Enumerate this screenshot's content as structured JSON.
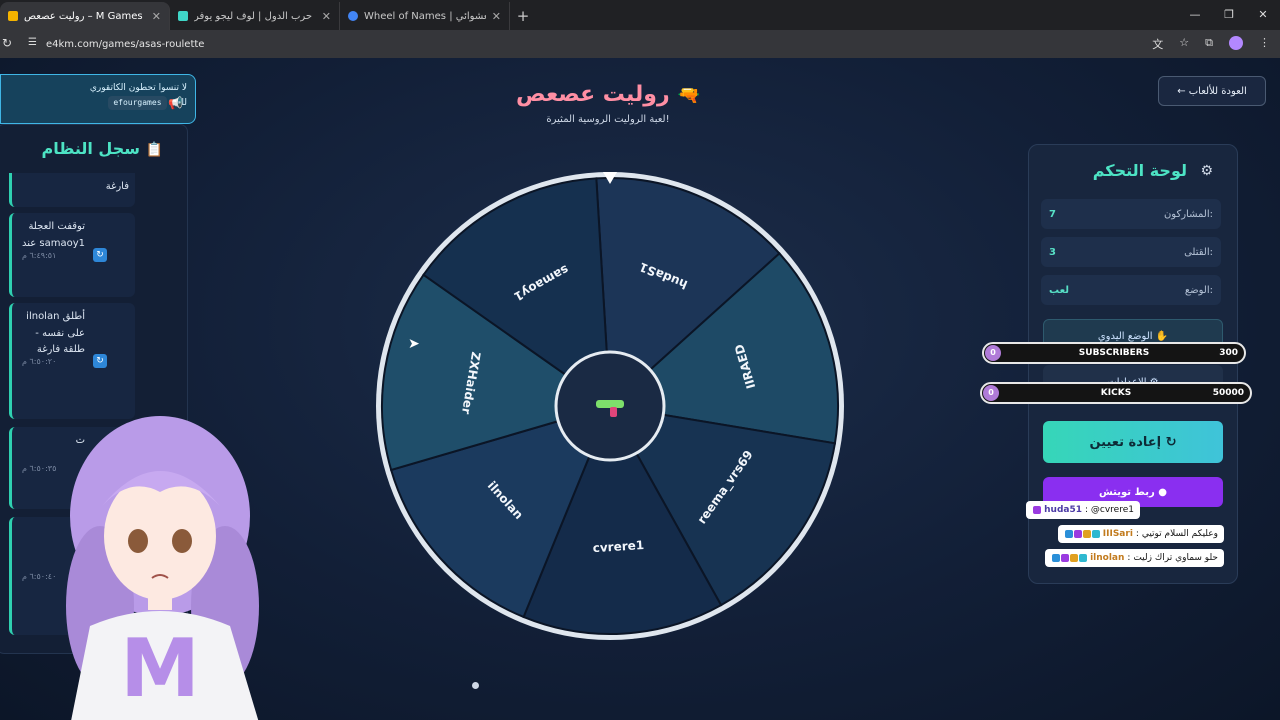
{
  "browser": {
    "tabs": [
      {
        "title": "روليت عصعص – M Games",
        "fav_color": "#f5b400"
      },
      {
        "title": "لعبة حرب الدول | لوف ليجو يوفر",
        "fav_color": "#3fd6c7"
      },
      {
        "title": "Wheel of Names | اسم العشوائي",
        "fav_color": "#4285f4"
      }
    ],
    "url": "e4km.com/games/asas-roulette"
  },
  "notice": {
    "text": "لا تنسوا تحطون الكاتقوري",
    "code": "efourgames",
    "suffix": "للعبة"
  },
  "syslog": {
    "title": "سجل النظام",
    "items": [
      {
        "text": "فارغة",
        "time": ""
      },
      {
        "text": "توقفت العجلة عند samaoy1",
        "time": "٦:٤٩:٥١ م"
      },
      {
        "text": "ilnolan أطلق على نفسه - طلقة فارغة",
        "time": "٦:٥٠:٢٠ م"
      },
      {
        "text": "ت",
        "time": "٦:٥٠:٣٥ م"
      },
      {
        "text": "",
        "time": "٦:٥٠:٤٠ م"
      }
    ]
  },
  "header": {
    "back_label": "← العودة للألعاب",
    "title": "روليت عصعص",
    "subtitle": "لعبة الروليت الروسية المثيرة!"
  },
  "wheel": {
    "players": [
      "hudaS1",
      "IIRAED",
      "reema_vrs69",
      "cvrere1",
      "ilnolan",
      "ZXHaider",
      "samaoy1"
    ],
    "colors": [
      "#1c3557",
      "#1e4a66",
      "#173352",
      "#142b4a",
      "#1b3a5e",
      "#1f4e6a",
      "#15304f"
    ]
  },
  "panel": {
    "title": "لوحة التحكم",
    "stats": [
      {
        "label": "المشاركون:",
        "value": "7"
      },
      {
        "label": "القتلى:",
        "value": "3"
      },
      {
        "label": "الوضع:",
        "value": "لعب"
      }
    ],
    "manual_label": "الوضع اليدوي",
    "settings_label": "الإعدادات",
    "reset_label": "إعادة تعيين",
    "twitch_label": "ربط تويتش"
  },
  "overlay": {
    "subscribers": {
      "label": "SUBSCRIBERS",
      "current": "0",
      "goal": "300"
    },
    "kicks": {
      "label": "KICKS",
      "current": "0",
      "goal": "50000"
    },
    "chat": [
      {
        "user": "huda51",
        "message": "@cvrere1"
      },
      {
        "user": "IIISari",
        "message": "وعليكم السلام توتيي"
      },
      {
        "user": "ilnolan",
        "message": "حلو سماوي تراك زليت"
      }
    ]
  }
}
